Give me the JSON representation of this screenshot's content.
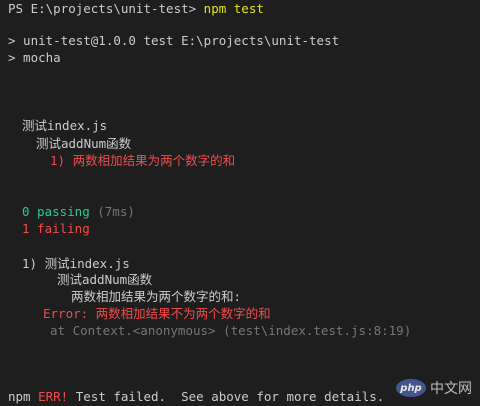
{
  "terminal": {
    "prompt": "PS E:\\projects\\unit-test> ",
    "command": "npm test",
    "script_line1": "> unit-test@1.0.0 test E:\\projects\\unit-test",
    "script_line2": "> mocha",
    "suite": "测试index.js",
    "subsuite": "测试addNum函数",
    "failed_case": "1) 两数相加结果为两个数字的和",
    "passing_label": "0 passing",
    "passing_time": " (7ms)",
    "failing_label": "1 failing",
    "detail_header": "1) 测试index.js",
    "detail_subsuite": "测试addNum函数",
    "detail_case": "两数相加结果为两个数字的和:",
    "error_message": "Error: 两数相加结果不为两个数字的和",
    "stack_trace": "at Context.<anonymous> (test\\index.test.js:8:19)",
    "npm_prefix": "npm ",
    "npm_err": "ERR!",
    "npm_msg": " Test failed.  See above for more details."
  },
  "watermark": {
    "badge": "php",
    "text": "中文网"
  },
  "colors": {
    "background": "#1e1e1e",
    "text": "#cccccc",
    "yellow": "#e5e510",
    "green": "#23d18b",
    "red": "#f14c4c",
    "gray": "#767676"
  }
}
